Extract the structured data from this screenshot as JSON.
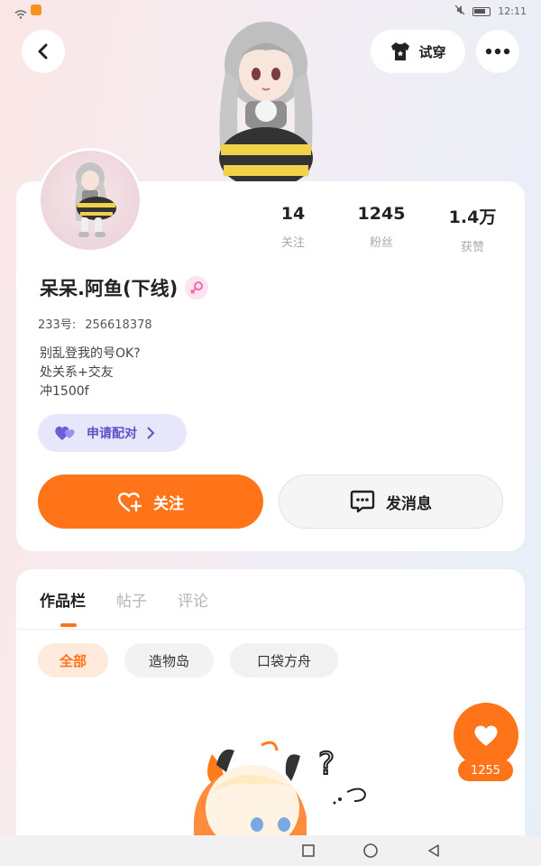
{
  "status_bar": {
    "time": "12:11"
  },
  "header": {
    "try_on_label": "试穿"
  },
  "profile": {
    "stats": [
      {
        "value": "14",
        "label": "关注"
      },
      {
        "value": "1245",
        "label": "粉丝"
      },
      {
        "value": "1.4万",
        "label": "获赞"
      }
    ],
    "username": "呆呆.阿鱼(下线)",
    "uid_label": "233号:",
    "uid_value": "256618378",
    "bio_lines": [
      "别乱登我的号OK?",
      "处关系+交友",
      "冲1500f"
    ],
    "pair_label": "申请配对",
    "follow_label": "关注",
    "message_label": "发消息"
  },
  "works": {
    "tabs": [
      "作品栏",
      "帖子",
      "评论"
    ],
    "chips": [
      "全部",
      "造物岛",
      "口袋方舟"
    ]
  },
  "like_count": "1255",
  "colors": {
    "accent": "#ff7418",
    "pair_purple": "#5b52c7"
  }
}
